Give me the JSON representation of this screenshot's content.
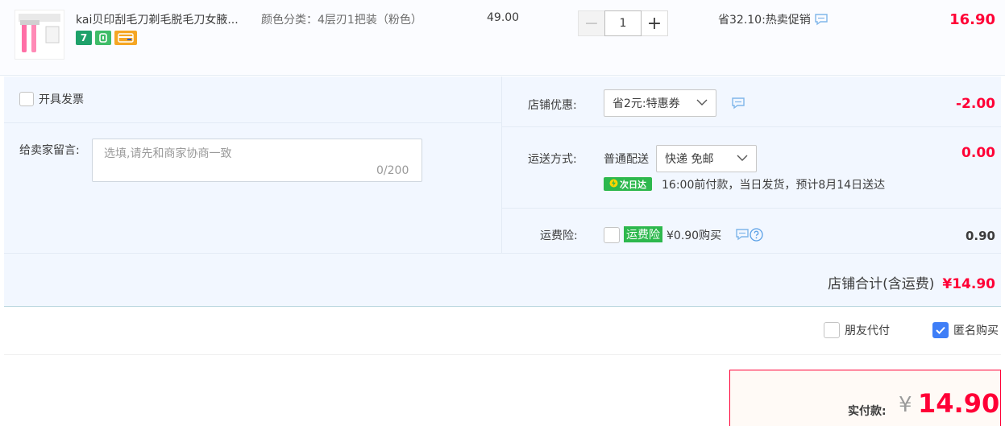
{
  "product": {
    "title": "kai贝印刮毛刀剃毛脱毛刀女腋...",
    "sku": "颜色分类：4层刃1把装（粉色）",
    "price": "49.00",
    "quantity": "1",
    "qty_minus": "−",
    "qty_plus": "+",
    "promo": "省32.10:热卖促销",
    "total": "16.90",
    "badges": [
      {
        "label": "7",
        "color": "#1ea16a"
      },
      {
        "label": "◘",
        "color": "#3fbc68"
      },
      {
        "label": "▬",
        "color": "#f5a623"
      }
    ]
  },
  "invoice": {
    "label": "开具发票"
  },
  "message": {
    "label": "给卖家留言:",
    "placeholder": "选填,请先和商家协商一致",
    "counter": "0/200"
  },
  "store_discount": {
    "label": "店铺优惠:",
    "selected": "省2元:特惠券",
    "amount": "-2.00"
  },
  "shipping": {
    "label": "运送方式:",
    "method": "普通配送",
    "selected": "快递 免邮",
    "amount": "0.00",
    "next_day_badge": "次日达",
    "delivery_note": "16:00前付款，当日发货，预计8月14日送达"
  },
  "insurance": {
    "label": "运费险:",
    "tag": "运费险",
    "price_text": "¥0.90购买",
    "amount": "0.90"
  },
  "store_total": {
    "label": "店铺合计(含运费)",
    "value": "¥14.90"
  },
  "options": {
    "friend_pay": "朋友代付",
    "anonymous": "匿名购买"
  },
  "payment": {
    "label": "实付款:",
    "currency": "¥",
    "value": "14.90"
  },
  "colors": {
    "accent_red": "#ff0036",
    "brand_green": "#2db84d",
    "check_blue": "#3e7ef7"
  }
}
